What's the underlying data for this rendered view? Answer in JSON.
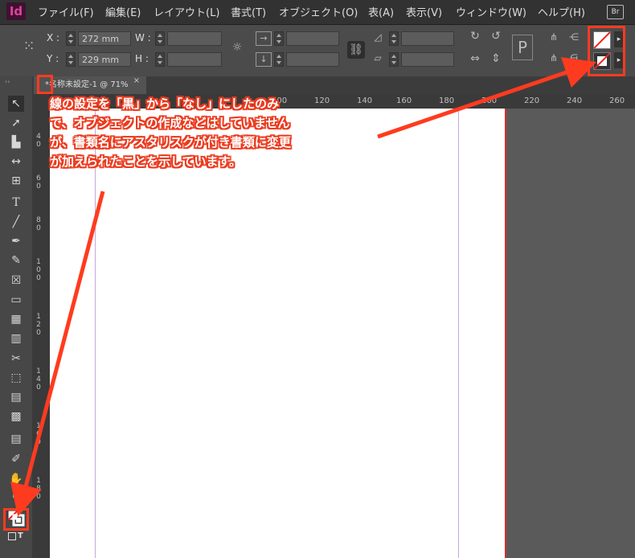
{
  "app": {
    "logo": "Id",
    "bridge_button": "Br"
  },
  "menu": [
    {
      "label": "ファイル(F)"
    },
    {
      "label": "編集(E)"
    },
    {
      "label": "レイアウト(L)"
    },
    {
      "label": "書式(T)"
    },
    {
      "label": "オブジェクト(O)"
    },
    {
      "label": "表(A)"
    },
    {
      "label": "表示(V)"
    },
    {
      "label": "ウィンドウ(W)"
    },
    {
      "label": "ヘルプ(H)"
    }
  ],
  "control": {
    "x_label": "X :",
    "x_value": "272 mm",
    "y_label": "Y :",
    "y_value": "229 mm",
    "w_label": "W :",
    "h_label": "H :"
  },
  "document_tab": {
    "title": "*名称未設定-1 @ 71%",
    "close": "×"
  },
  "hruler": [
    "100",
    "120",
    "140",
    "160",
    "180",
    "200",
    "220",
    "240",
    "260"
  ],
  "vruler": [
    "4 0",
    "6 0",
    "8 0",
    "1 0 0",
    "1 2 0",
    "1 4 0",
    "1 6 0",
    "1 8 0"
  ],
  "annotation": {
    "lines": [
      "線の設定を「黒」から「なし」にしたのみ",
      "で、オブジェクトの作成などはしていません",
      "が、書類名にアスタリスクが付き書類に変更",
      "が加えられたことを示しています。"
    ],
    "color": "#ff3b1f"
  },
  "tools": [
    "selection-tool",
    "direct-selection-tool",
    "page-tool",
    "gap-tool",
    "content-collector-tool",
    "type-tool",
    "line-tool",
    "pen-tool",
    "pencil-tool",
    "rectangle-frame-tool",
    "rectangle-tool",
    "table-tool",
    "grid-tool",
    "scissors-tool",
    "free-transform-tool",
    "gradient-swatch-tool",
    "gradient-feather-tool",
    "note-tool",
    "eyedropper-tool",
    "hand-tool",
    "zoom-tool"
  ]
}
